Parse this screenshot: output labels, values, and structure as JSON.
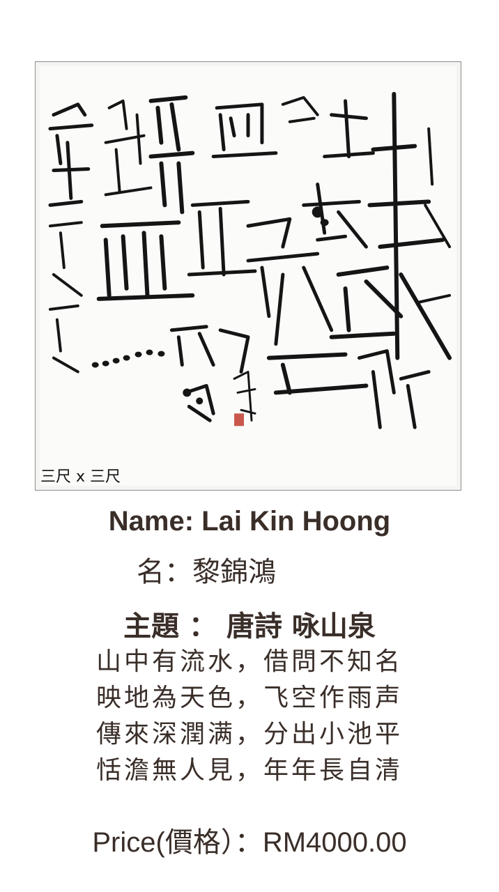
{
  "artwork": {
    "size_label": "三尺 x 三尺",
    "seal_text": "錦鴻"
  },
  "name_line": "Name: Lai Kin Hoong",
  "name_zh_line": "名：黎錦鴻",
  "theme_line": "主題 ： 唐詩 咏山泉",
  "poem": [
    "山中有流水，借問不知名",
    "映地為天色，飞空作雨声",
    "傳來深潤满，分出小池平",
    "恬澹無人見，年年長自清"
  ],
  "price_line": "Price(價格）：RM4000.00",
  "colors": {
    "text": "#3a2e29",
    "ink": "#111111",
    "seal": "#c0392b"
  }
}
